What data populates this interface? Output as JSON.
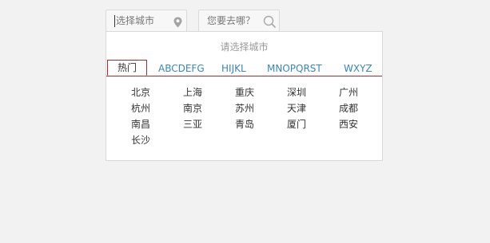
{
  "city_input": {
    "placeholder": "选择城市",
    "icon": "map-pin-icon"
  },
  "search_input": {
    "placeholder": "您要去哪？",
    "icon": "search-icon"
  },
  "dropdown": {
    "prompt": "请选择城市",
    "tabs": [
      {
        "label": "热门",
        "active": true
      },
      {
        "label": "ABCDEFG",
        "active": false
      },
      {
        "label": "HIJKL",
        "active": false
      },
      {
        "label": "MNOPQRST",
        "active": false
      },
      {
        "label": "WXYZ",
        "active": false
      }
    ],
    "cities": [
      "北京",
      "上海",
      "重庆",
      "深圳",
      "广州",
      "杭州",
      "南京",
      "苏州",
      "天津",
      "成都",
      "南昌",
      "三亚",
      "青岛",
      "厦门",
      "西安",
      "长沙"
    ]
  },
  "colors": {
    "background": "#f2f2f3",
    "accent_red": "#b2262d",
    "tab_link_blue": "#3d84b7",
    "text_dark": "#333333",
    "text_muted": "#9a9a9a"
  }
}
